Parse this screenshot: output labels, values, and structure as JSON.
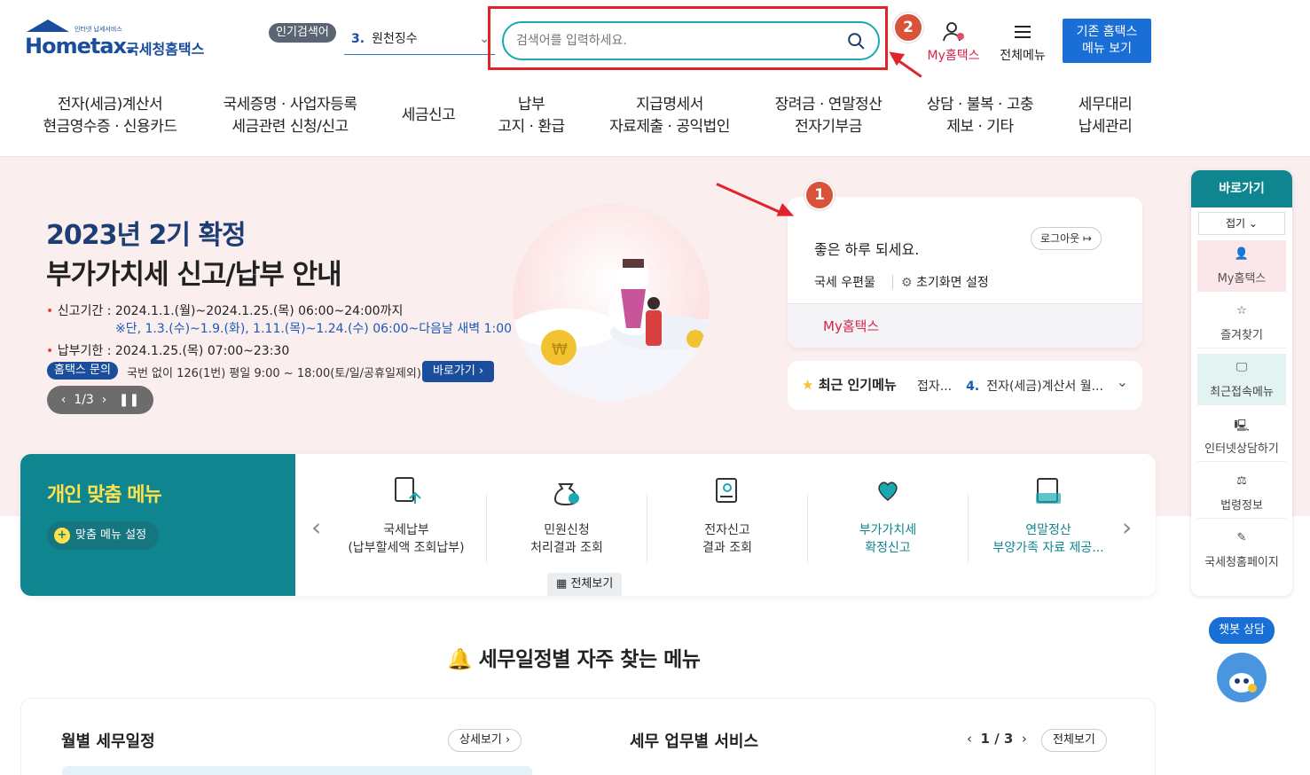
{
  "header": {
    "logo_small": "인터넷 납세서비스",
    "logo_text": "Hometax.",
    "logo_kr": "국세청홈택스",
    "popular_label": "인기검색어",
    "popular_num": "3.",
    "popular_keyword": "원천징수",
    "search_placeholder": "검색어를 입력하세요.",
    "myhometax": "My홈택스",
    "all_menu": "전체메뉴",
    "old_menu_line1": "기존 홈택스",
    "old_menu_line2": "메뉴 보기",
    "badge2": "2"
  },
  "nav": [
    {
      "l1": "전자(세금)계산서",
      "l2": "현금영수증 · 신용카드"
    },
    {
      "l1": "국세증명 · 사업자등록",
      "l2": "세금관련 신청/신고"
    },
    {
      "l1": "세금신고",
      "l2": ""
    },
    {
      "l1": "납부",
      "l2": "고지 · 환급"
    },
    {
      "l1": "지급명세서",
      "l2": "자료제출 · 공익법인"
    },
    {
      "l1": "장려금 · 연말정산",
      "l2": "전자기부금"
    },
    {
      "l1": "상담 · 불복 · 고충",
      "l2": "제보 · 기타"
    },
    {
      "l1": "세무대리",
      "l2": "납세관리"
    }
  ],
  "hero": {
    "title1": "2023년 2기 확정",
    "title2": "부가가치세 신고/납부 안내",
    "period_label": "신고기간 :",
    "period_value": "2024.1.1.(월)~2024.1.25.(목) 06:00~24:00까지",
    "period_note": "※단, 1.3.(수)~1.9.(화), 1.11.(목)~1.24.(수) 06:00~다음날 새벽 1:00",
    "due_label": "납부기한 :",
    "due_value": "2024.1.25.(목) 07:00~23:30",
    "inquiry_tag": "홈택스 문의",
    "inquiry_text": "국번 없이 126(1번) 평일 9:00 ~ 18:00(토/일/공휴일제외)",
    "goto_btn": "바로가기",
    "pager": "1/3"
  },
  "login": {
    "badge1": "1",
    "greeting": "좋은 하루 되세요.",
    "logout": "로그아웃",
    "mailbox": "국세 우편물",
    "initial_setting": "초기화면 설정",
    "myhometax": "My홈택스"
  },
  "recent": {
    "title": "최근 인기메뉴",
    "prev_item": "접자...",
    "num": "4.",
    "item": "전자(세금)계산서 월..."
  },
  "custom": {
    "title_a": "개인",
    "title_b": " 맞춤 메뉴",
    "set_label": "맞춤 메뉴 설정",
    "items": [
      {
        "l1": "국세납부",
        "l2": "(납부할세액 조회납부)"
      },
      {
        "l1": "민원신청",
        "l2": "처리결과 조회"
      },
      {
        "l1": "전자신고",
        "l2": "결과 조회"
      },
      {
        "l1": "부가가치세",
        "l2": "확정신고"
      },
      {
        "l1": "연말정산",
        "l2": "부양가족 자료 제공..."
      }
    ],
    "view_all": "전체보기"
  },
  "schedule": {
    "title": "세무일정별 자주 찾는 메뉴",
    "monthly": "월별 세무일정",
    "detail": "상세보기",
    "service": "세무 업무별 서비스",
    "pager": "1 / 3",
    "view_all": "전체보기"
  },
  "quick": {
    "title": "바로가기",
    "fold": "접기",
    "items": [
      "My홈택스",
      "즐겨찾기",
      "최근접속메뉴",
      "인터넷상담하기",
      "법령정보",
      "국세청홈페이지"
    ],
    "chatbot": "챗봇 상담"
  },
  "colors": {
    "brand": "#1a4d9c",
    "teal": "#0f8590",
    "accent_red": "#e0242a",
    "pink": "#d4244c"
  }
}
